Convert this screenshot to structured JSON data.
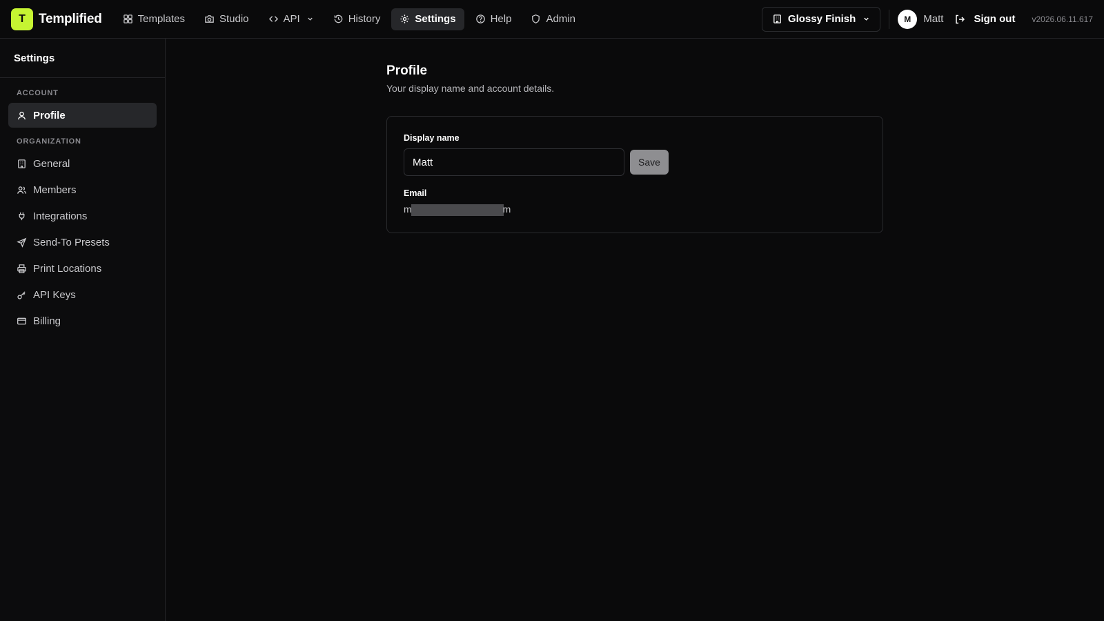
{
  "brand": {
    "logo_letter": "T",
    "name": "Templified",
    "accent": "#c6f432"
  },
  "nav": [
    {
      "label": "Templates",
      "icon": "grid-icon"
    },
    {
      "label": "Studio",
      "icon": "camera-icon"
    },
    {
      "label": "API",
      "icon": "code-icon"
    },
    {
      "label": "History",
      "icon": "history-icon"
    },
    {
      "label": "Settings",
      "icon": "gear-icon",
      "active": true
    },
    {
      "label": "Help",
      "icon": "help-circle-icon"
    },
    {
      "label": "Admin",
      "icon": "shield-icon"
    }
  ],
  "org": {
    "name": "Glossy Finish"
  },
  "user": {
    "initial": "M",
    "name": "Matt"
  },
  "signout_label": "Sign out",
  "version": "v2026.06.11.617",
  "sidebar": {
    "title": "Settings",
    "sections": [
      {
        "label": "ACCOUNT",
        "items": [
          {
            "label": "Profile",
            "icon": "user-icon",
            "active": true
          }
        ]
      },
      {
        "label": "ORGANIZATION",
        "items": [
          {
            "label": "General",
            "icon": "building-icon"
          },
          {
            "label": "Members",
            "icon": "users-icon"
          },
          {
            "label": "Integrations",
            "icon": "plug-icon"
          },
          {
            "label": "Send-To Presets",
            "icon": "send-icon"
          },
          {
            "label": "Print Locations",
            "icon": "printer-icon"
          },
          {
            "label": "API Keys",
            "icon": "key-icon"
          },
          {
            "label": "Billing",
            "icon": "credit-card-icon"
          }
        ]
      }
    ]
  },
  "profile": {
    "title": "Profile",
    "subtitle": "Your display name and account details.",
    "display_name_label": "Display name",
    "display_name_value": "Matt",
    "save_label": "Save",
    "email_label": "Email",
    "email_start": "m",
    "email_end": "m"
  }
}
